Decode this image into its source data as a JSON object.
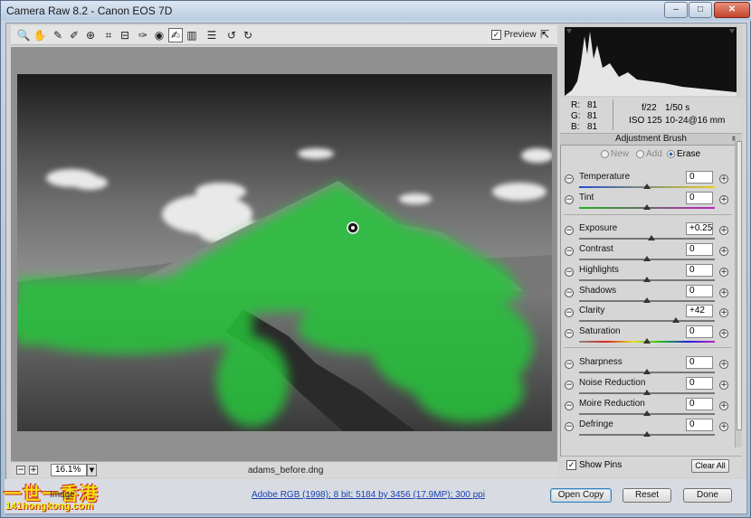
{
  "window": {
    "title": "Camera Raw 8.2  -  Canon EOS 7D",
    "min_glyph": "–",
    "max_glyph": "□",
    "close_glyph": "✕"
  },
  "toolbar": {
    "tools": [
      {
        "name": "zoom-tool",
        "glyph": "🔍"
      },
      {
        "name": "hand-tool",
        "glyph": "✋"
      },
      {
        "name": "white-balance-tool",
        "glyph": "✎"
      },
      {
        "name": "color-sampler-tool",
        "glyph": "✐"
      },
      {
        "name": "targeted-adjustment-tool",
        "glyph": "⊕"
      },
      {
        "name": "crop-tool",
        "glyph": "⌗"
      },
      {
        "name": "straighten-tool",
        "glyph": "⊟"
      },
      {
        "name": "spot-removal-tool",
        "glyph": "✑"
      },
      {
        "name": "red-eye-tool",
        "glyph": "◉"
      },
      {
        "name": "adjustment-brush-tool",
        "glyph": "✍"
      },
      {
        "name": "graduated-filter-tool",
        "glyph": "▥"
      },
      {
        "name": "radial-filter-tool",
        "glyph": "☰"
      },
      {
        "name": "rotate-left-tool",
        "glyph": "↺"
      },
      {
        "name": "rotate-right-tool",
        "glyph": "↻"
      }
    ],
    "preview_label": "Preview",
    "preview_checked": "✓",
    "fullscreen_glyph": "⇱"
  },
  "status": {
    "zoom_out_glyph": "−",
    "zoom_in_glyph": "+",
    "zoom_value": "16.1%",
    "zoom_dd": "▼",
    "filename": "adams_before.dng"
  },
  "readout": {
    "r_label": "R:",
    "r_value": "81",
    "g_label": "G:",
    "g_value": "81",
    "b_label": "B:",
    "b_value": "81",
    "aperture": "f/22",
    "shutter": "1/50 s",
    "iso": "ISO 125",
    "lens": "10-24@16 mm"
  },
  "panel": {
    "title": "Adjustment Brush",
    "menu_glyph": "≡",
    "modes": [
      {
        "label": "New",
        "selected": false
      },
      {
        "label": "Add",
        "selected": false
      },
      {
        "label": "Erase",
        "selected": true
      }
    ],
    "sliders": [
      {
        "label": "Temperature",
        "value": "0",
        "pos": 0.5,
        "track": "linear-gradient(90deg,#2050d0,#e8d020)"
      },
      {
        "label": "Tint",
        "value": "0",
        "pos": 0.5,
        "track": "linear-gradient(90deg,#20b020,#c020c0)"
      },
      {
        "label": "Exposure",
        "value": "+0.25",
        "pos": 0.53,
        "track": "#777"
      },
      {
        "label": "Contrast",
        "value": "0",
        "pos": 0.5,
        "track": "#777"
      },
      {
        "label": "Highlights",
        "value": "0",
        "pos": 0.5,
        "track": "#777"
      },
      {
        "label": "Shadows",
        "value": "0",
        "pos": 0.5,
        "track": "#777"
      },
      {
        "label": "Clarity",
        "value": "+42",
        "pos": 0.71,
        "track": "#777"
      },
      {
        "label": "Saturation",
        "value": "0",
        "pos": 0.5,
        "track": "linear-gradient(90deg,#888,#e02020,#e0e020,#20c020,#2020e0,#c020c0)"
      },
      {
        "label": "Sharpness",
        "value": "0",
        "pos": 0.5,
        "track": "#777"
      },
      {
        "label": "Noise Reduction",
        "value": "0",
        "pos": 0.5,
        "track": "#777"
      },
      {
        "label": "Moire Reduction",
        "value": "0",
        "pos": 0.5,
        "track": "#777"
      },
      {
        "label": "Defringe",
        "value": "0",
        "pos": 0.5,
        "track": "#777"
      }
    ],
    "minus_glyph": "−",
    "plus_glyph": "+",
    "show_pins_label": "Show Pins",
    "show_pins_checked": "✓",
    "clear_all_label": "Clear All"
  },
  "footer": {
    "image_label": "Image",
    "workflow_link": "Adobe RGB (1998); 8 bit; 5184 by 3456 (17.9MP); 300 ppi",
    "open_copy": "Open Copy",
    "reset": "Reset",
    "done": "Done"
  },
  "watermark": {
    "line1": "一世一香港",
    "line2": "141hongkong.com"
  },
  "colors": {
    "mask": "#27c33b",
    "accent": "#2a6cc0"
  }
}
